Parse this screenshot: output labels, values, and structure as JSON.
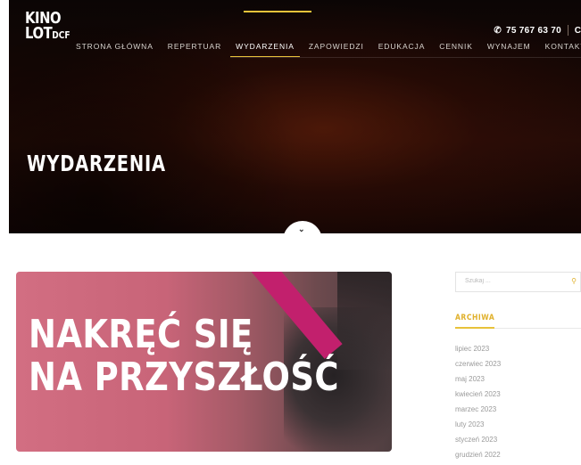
{
  "header": {
    "logo_line1": "KINO",
    "logo_line2": "LOT",
    "logo_sub": "DCF",
    "phone": "75 767 63 70",
    "phone_icon": "phone-icon",
    "extra": "C"
  },
  "nav": [
    {
      "label": "STRONA GŁÓWNA",
      "active": false
    },
    {
      "label": "REPERTUAR",
      "active": false
    },
    {
      "label": "WYDARZENIA",
      "active": true
    },
    {
      "label": "ZAPOWIEDZI",
      "active": false
    },
    {
      "label": "EDUKACJA",
      "active": false
    },
    {
      "label": "CENNIK",
      "active": false
    },
    {
      "label": "WYNAJEM",
      "active": false
    },
    {
      "label": "KONTAKT",
      "active": false
    }
  ],
  "hero": {
    "title": "WYDARZENIA",
    "scroll_icon": "chevron-down-icon"
  },
  "featured": {
    "headline_line1": "NAKRĘĆ SIĘ",
    "headline_line2": "NA PRZYSZŁOŚĆ"
  },
  "sidebar": {
    "search_placeholder": "Szukaj ...",
    "search_icon": "search-icon",
    "archive_title": "ARCHIWA",
    "archive_items": [
      "lipiec 2023",
      "czerwiec 2023",
      "maj 2023",
      "kwiecień 2023",
      "marzec 2023",
      "luty 2023",
      "styczeń 2023",
      "grudzień 2022"
    ]
  },
  "colors": {
    "accent": "#e8c23a",
    "top_strip": "#2b6fd6",
    "magenta": "#c2206d"
  }
}
